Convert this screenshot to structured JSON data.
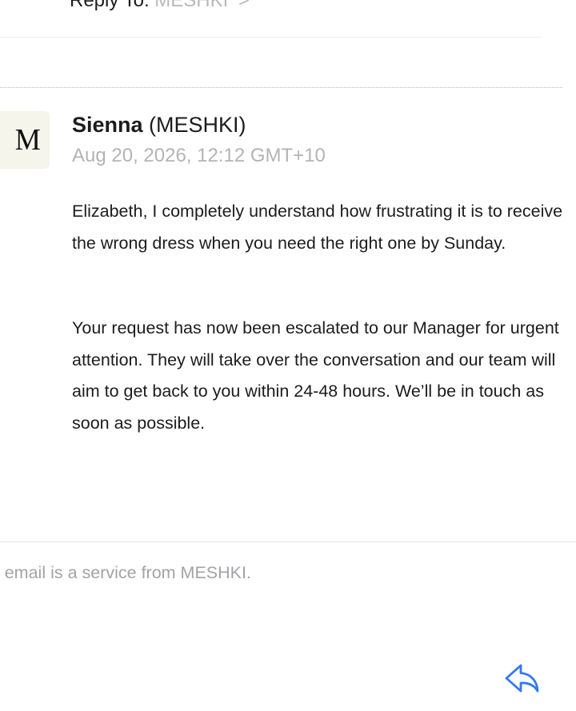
{
  "header": {
    "reply_to_label": "Reply To:",
    "reply_to_value": "MESHKI",
    "reply_to_chevron": ">"
  },
  "message": {
    "avatar_letter": "M",
    "sender_name": "Sienna",
    "sender_org": "(MESHKI)",
    "date": "Aug 20, 2026, 12:12 GMT+10",
    "paragraphs": [
      "Elizabeth, I completely understand how frustrating it is to receive the wrong dress when you need the right one by Sunday.",
      "Your request has now been escalated to our Manager for urgent attention. They will take over the conversation and our team will aim to get back to you within 24-48 hours. We’ll be in touch as soon as possible."
    ]
  },
  "footer": {
    "note": "s email is a service from MESHKI."
  },
  "toolbar": {
    "reply_icon": "reply-arrow-icon",
    "accent_color": "#3478f6"
  }
}
